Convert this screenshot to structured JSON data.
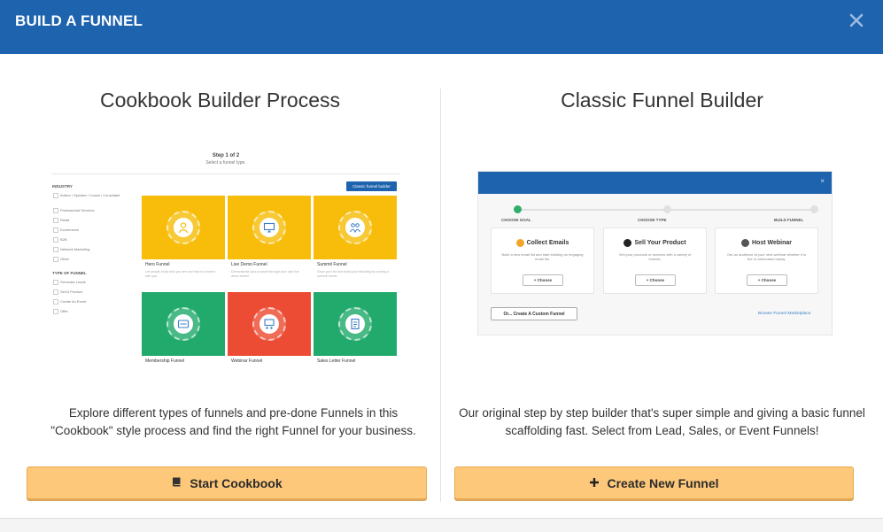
{
  "modal": {
    "title": "BUILD A FUNNEL",
    "close_icon": "close-icon"
  },
  "cookbook": {
    "title": "Cookbook Builder Process",
    "description": "Explore different types of funnels and pre-done Funnels in this \"Cookbook\" style process and find the right Funnel for your business.",
    "button_label": "Start Cookbook",
    "button_icon": "book-icon",
    "button_color": "#fec87a",
    "preview": {
      "step": "Step 1 of 2",
      "subtitle": "Select a funnel type.",
      "classic_button": "Classic funnel builder",
      "industry_label": "INDUSTRY",
      "industry_options": [
        "Author / Speaker / Coach / Consultant",
        "Professional Services",
        "Retail",
        "Ecommerce",
        "B2B",
        "Network Marketing",
        "Other"
      ],
      "type_label": "TYPE OF FUNNEL",
      "type_options": [
        "Generate Leads",
        "Sell A Product",
        "Create An Event",
        "Offer"
      ],
      "funnels": [
        {
          "name": "Hero Funnel",
          "text": "Let people know who you are and how to connect with you.",
          "color": "#f7bd0a",
          "icon": "person-icon"
        },
        {
          "name": "Live Demo Funnel",
          "text": "Demonstrate your product through your own live demo funnel.",
          "color": "#f7bd0a",
          "icon": "monitor-icon"
        },
        {
          "name": "Summit Funnel",
          "text": "Grow your list and build your following by running a summit funnel.",
          "color": "#f7bd0a",
          "icon": "people-icon"
        },
        {
          "name": "Membership Funnel",
          "text": "",
          "color": "#21aa6c",
          "icon": "card-icon"
        },
        {
          "name": "Webinar Funnel",
          "text": "",
          "color": "#ec4c33",
          "icon": "presentation-icon"
        },
        {
          "name": "Sales Letter Funnel",
          "text": "",
          "color": "#21aa6c",
          "icon": "letter-icon"
        }
      ]
    }
  },
  "classic": {
    "title": "Classic Funnel Builder",
    "description": "Our original step by step builder that's super simple and giving a basic funnel scaffolding fast. Select from Lead, Sales, or Event Funnels!",
    "button_label": "Create New Funnel",
    "button_icon": "plus-icon",
    "button_color": "#fec87a",
    "preview": {
      "close_char": "×",
      "steps": [
        "CHOOSE GOAL",
        "CHOOSE TYPE",
        "BUILD FUNNEL"
      ],
      "cards": [
        {
          "title": "Collect Emails",
          "desc": "Build a new email list and start building an engaging email list.",
          "button": "+ Choose",
          "icon_color": "#f3a42a"
        },
        {
          "title": "Sell Your Product",
          "desc": "Sell your products or services with a variety of funnels.",
          "button": "+ Choose",
          "icon_color": "#222222"
        },
        {
          "title": "Host Webinar",
          "desc": "Get an audience at your next webinar whether it is live or automated replay.",
          "button": "+ Choose",
          "icon_color": "#555555"
        }
      ],
      "custom_button": "Or... Create A Custom Funnel",
      "marketplace_link": "Browse Funnel Marketplace"
    }
  },
  "colors": {
    "header": "#1e63ad",
    "accent_green": "#2fae6a"
  }
}
